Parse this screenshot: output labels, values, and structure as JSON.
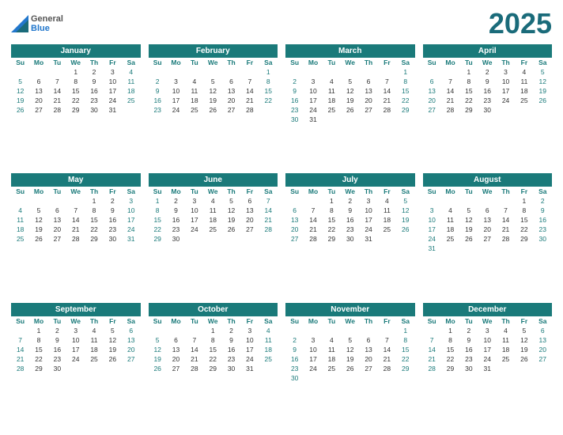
{
  "year": "2025",
  "months": [
    {
      "name": "January",
      "days_header": [
        "Su",
        "Mo",
        "Tu",
        "We",
        "Th",
        "Fr",
        "Sa"
      ],
      "weeks": [
        [
          "",
          "",
          "",
          "1",
          "2",
          "3",
          "4"
        ],
        [
          "5",
          "6",
          "7",
          "8",
          "9",
          "10",
          "11"
        ],
        [
          "12",
          "13",
          "14",
          "15",
          "16",
          "17",
          "18"
        ],
        [
          "19",
          "20",
          "21",
          "22",
          "23",
          "24",
          "25"
        ],
        [
          "26",
          "27",
          "28",
          "29",
          "30",
          "31",
          ""
        ]
      ]
    },
    {
      "name": "February",
      "days_header": [
        "Su",
        "Mo",
        "Tu",
        "We",
        "Th",
        "Fr",
        "Sa"
      ],
      "weeks": [
        [
          "",
          "",
          "",
          "",
          "",
          "",
          "1"
        ],
        [
          "2",
          "3",
          "4",
          "5",
          "6",
          "7",
          "8"
        ],
        [
          "9",
          "10",
          "11",
          "12",
          "13",
          "14",
          "15"
        ],
        [
          "16",
          "17",
          "18",
          "19",
          "20",
          "21",
          "22"
        ],
        [
          "23",
          "24",
          "25",
          "26",
          "27",
          "28",
          ""
        ]
      ]
    },
    {
      "name": "March",
      "days_header": [
        "Su",
        "Mo",
        "Tu",
        "We",
        "Th",
        "Fr",
        "Sa"
      ],
      "weeks": [
        [
          "",
          "",
          "",
          "",
          "",
          "",
          "1"
        ],
        [
          "2",
          "3",
          "4",
          "5",
          "6",
          "7",
          "8"
        ],
        [
          "9",
          "10",
          "11",
          "12",
          "13",
          "14",
          "15"
        ],
        [
          "16",
          "17",
          "18",
          "19",
          "20",
          "21",
          "22"
        ],
        [
          "23",
          "24",
          "25",
          "26",
          "27",
          "28",
          "29"
        ],
        [
          "30",
          "31",
          "",
          "",
          "",
          "",
          ""
        ]
      ]
    },
    {
      "name": "April",
      "days_header": [
        "Su",
        "Mo",
        "Tu",
        "We",
        "Th",
        "Fr",
        "Sa"
      ],
      "weeks": [
        [
          "",
          "",
          "1",
          "2",
          "3",
          "4",
          "5"
        ],
        [
          "6",
          "7",
          "8",
          "9",
          "10",
          "11",
          "12"
        ],
        [
          "13",
          "14",
          "15",
          "16",
          "17",
          "18",
          "19"
        ],
        [
          "20",
          "21",
          "22",
          "23",
          "24",
          "25",
          "26"
        ],
        [
          "27",
          "28",
          "29",
          "30",
          "",
          "",
          ""
        ]
      ]
    },
    {
      "name": "May",
      "days_header": [
        "Su",
        "Mo",
        "Tu",
        "We",
        "Th",
        "Fr",
        "Sa"
      ],
      "weeks": [
        [
          "",
          "",
          "",
          "",
          "1",
          "2",
          "3"
        ],
        [
          "4",
          "5",
          "6",
          "7",
          "8",
          "9",
          "10"
        ],
        [
          "11",
          "12",
          "13",
          "14",
          "15",
          "16",
          "17"
        ],
        [
          "18",
          "19",
          "20",
          "21",
          "22",
          "23",
          "24"
        ],
        [
          "25",
          "26",
          "27",
          "28",
          "29",
          "30",
          "31"
        ]
      ]
    },
    {
      "name": "June",
      "days_header": [
        "Su",
        "Mo",
        "Tu",
        "We",
        "Th",
        "Fr",
        "Sa"
      ],
      "weeks": [
        [
          "1",
          "2",
          "3",
          "4",
          "5",
          "6",
          "7"
        ],
        [
          "8",
          "9",
          "10",
          "11",
          "12",
          "13",
          "14"
        ],
        [
          "15",
          "16",
          "17",
          "18",
          "19",
          "20",
          "21"
        ],
        [
          "22",
          "23",
          "24",
          "25",
          "26",
          "27",
          "28"
        ],
        [
          "29",
          "30",
          "",
          "",
          "",
          "",
          ""
        ]
      ]
    },
    {
      "name": "July",
      "days_header": [
        "Su",
        "Mo",
        "Tu",
        "We",
        "Th",
        "Fr",
        "Sa"
      ],
      "weeks": [
        [
          "",
          "",
          "1",
          "2",
          "3",
          "4",
          "5"
        ],
        [
          "6",
          "7",
          "8",
          "9",
          "10",
          "11",
          "12"
        ],
        [
          "13",
          "14",
          "15",
          "16",
          "17",
          "18",
          "19"
        ],
        [
          "20",
          "21",
          "22",
          "23",
          "24",
          "25",
          "26"
        ],
        [
          "27",
          "28",
          "29",
          "30",
          "31",
          "",
          ""
        ]
      ]
    },
    {
      "name": "August",
      "days_header": [
        "Su",
        "Mo",
        "Tu",
        "We",
        "Th",
        "Fr",
        "Sa"
      ],
      "weeks": [
        [
          "",
          "",
          "",
          "",
          "",
          "1",
          "2"
        ],
        [
          "3",
          "4",
          "5",
          "6",
          "7",
          "8",
          "9"
        ],
        [
          "10",
          "11",
          "12",
          "13",
          "14",
          "15",
          "16"
        ],
        [
          "17",
          "18",
          "19",
          "20",
          "21",
          "22",
          "23"
        ],
        [
          "24",
          "25",
          "26",
          "27",
          "28",
          "29",
          "30"
        ],
        [
          "31",
          "",
          "",
          "",
          "",
          "",
          ""
        ]
      ]
    },
    {
      "name": "September",
      "days_header": [
        "Su",
        "Mo",
        "Tu",
        "We",
        "Th",
        "Fr",
        "Sa"
      ],
      "weeks": [
        [
          "",
          "1",
          "2",
          "3",
          "4",
          "5",
          "6"
        ],
        [
          "7",
          "8",
          "9",
          "10",
          "11",
          "12",
          "13"
        ],
        [
          "14",
          "15",
          "16",
          "17",
          "18",
          "19",
          "20"
        ],
        [
          "21",
          "22",
          "23",
          "24",
          "25",
          "26",
          "27"
        ],
        [
          "28",
          "29",
          "30",
          "",
          "",
          "",
          ""
        ]
      ]
    },
    {
      "name": "October",
      "days_header": [
        "Su",
        "Mo",
        "Tu",
        "We",
        "Th",
        "Fr",
        "Sa"
      ],
      "weeks": [
        [
          "",
          "",
          "",
          "1",
          "2",
          "3",
          "4"
        ],
        [
          "5",
          "6",
          "7",
          "8",
          "9",
          "10",
          "11"
        ],
        [
          "12",
          "13",
          "14",
          "15",
          "16",
          "17",
          "18"
        ],
        [
          "19",
          "20",
          "21",
          "22",
          "23",
          "24",
          "25"
        ],
        [
          "26",
          "27",
          "28",
          "29",
          "30",
          "31",
          ""
        ]
      ]
    },
    {
      "name": "November",
      "days_header": [
        "Su",
        "Mo",
        "Tu",
        "We",
        "Th",
        "Fr",
        "Sa"
      ],
      "weeks": [
        [
          "",
          "",
          "",
          "",
          "",
          "",
          "1"
        ],
        [
          "2",
          "3",
          "4",
          "5",
          "6",
          "7",
          "8"
        ],
        [
          "9",
          "10",
          "11",
          "12",
          "13",
          "14",
          "15"
        ],
        [
          "16",
          "17",
          "18",
          "19",
          "20",
          "21",
          "22"
        ],
        [
          "23",
          "24",
          "25",
          "26",
          "27",
          "28",
          "29"
        ],
        [
          "30",
          "",
          "",
          "",
          "",
          "",
          ""
        ]
      ]
    },
    {
      "name": "December",
      "days_header": [
        "Su",
        "Mo",
        "Tu",
        "We",
        "Th",
        "Fr",
        "Sa"
      ],
      "weeks": [
        [
          "",
          "1",
          "2",
          "3",
          "4",
          "5",
          "6"
        ],
        [
          "7",
          "8",
          "9",
          "10",
          "11",
          "12",
          "13"
        ],
        [
          "14",
          "15",
          "16",
          "17",
          "18",
          "19",
          "20"
        ],
        [
          "21",
          "22",
          "23",
          "24",
          "25",
          "26",
          "27"
        ],
        [
          "28",
          "29",
          "30",
          "31",
          "",
          "",
          ""
        ]
      ]
    }
  ]
}
